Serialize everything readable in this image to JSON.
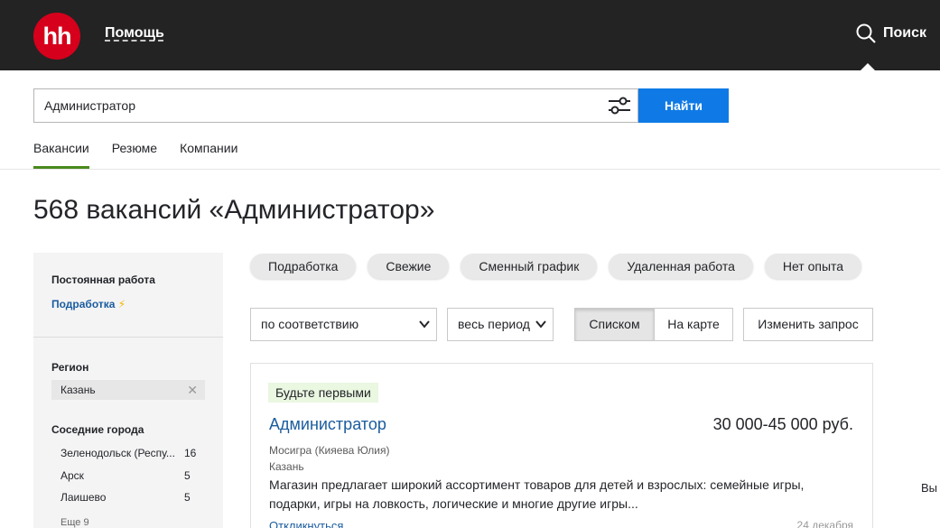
{
  "header": {
    "logo": "hh",
    "help_link": "Помощь",
    "search_link": "Поиск"
  },
  "search": {
    "query": "Администратор",
    "find_button": "Найти"
  },
  "tabs": [
    {
      "label": "Вакансии",
      "active": true
    },
    {
      "label": "Резюме",
      "active": false
    },
    {
      "label": "Компании",
      "active": false
    }
  ],
  "page_title": "568 вакансий «Администратор»",
  "sidebar": {
    "employment_title": "Постоянная работа",
    "parttime_link": "Подработка",
    "region_title": "Регион",
    "region_value": "Казань",
    "nearby_title": "Соседние города",
    "cities": [
      {
        "name": "Зеленодольск (Респу...",
        "count": "16"
      },
      {
        "name": "Арск",
        "count": "5"
      },
      {
        "name": "Лаишево",
        "count": "5"
      }
    ],
    "more_link": "Еще 9"
  },
  "chips": [
    "Подработка",
    "Свежие",
    "Сменный график",
    "Удаленная работа",
    "Нет опыта"
  ],
  "controls": {
    "sort_value": "по соответствию",
    "period_value": "весь период",
    "view_list": "Списком",
    "view_map": "На карте",
    "edit_query": "Изменить запрос"
  },
  "vacancy": {
    "badge": "Будьте первыми",
    "title": "Администратор",
    "salary": "30 000-45 000 руб.",
    "company": "Мосигра (Кияева Юлия)",
    "city": "Казань",
    "description": "Магазин предлагает широкий ассортимент товаров для детей и взрослых: семейные игры, подарки, игры на ловкость, логические и многие другие игры...",
    "respond": "Откликнуться",
    "date": "24 декабря"
  },
  "edge_text": "Вы",
  "colors": {
    "header_bg": "#232323",
    "logo_red": "#d6001c",
    "primary_blue": "#0f7ae5",
    "link_blue": "#1a5c9e",
    "tab_underline": "#4a8a1c",
    "badge_green": "#eaf7e1"
  }
}
